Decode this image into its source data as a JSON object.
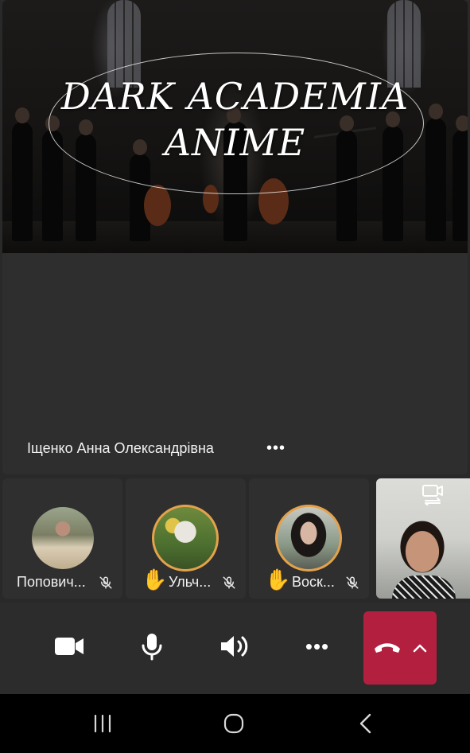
{
  "shared_content": {
    "title_line1": "DARK ACADEMIA",
    "title_line2": "ANIME"
  },
  "presenter": {
    "name": "Іщенко Анна Олександрівна",
    "more_label": "•••"
  },
  "participants": [
    {
      "label": "Попович...",
      "hand_raised": false,
      "muted": true,
      "hand": ""
    },
    {
      "label": "Ульч...",
      "hand_raised": true,
      "muted": true,
      "hand": "✋"
    },
    {
      "label": "Воск...",
      "hand_raised": true,
      "muted": true,
      "hand": "✋"
    }
  ],
  "self_view": {
    "icon": "switch-camera-icon"
  },
  "controls": {
    "camera_icon": "video-camera-icon",
    "mic_icon": "microphone-icon",
    "speaker_icon": "speaker-icon",
    "more_label": "•••",
    "end_call_icon": "hang-up-icon",
    "expand_icon": "chevron-up-icon"
  },
  "colors": {
    "background": "#292929",
    "end_call": "#b3203f",
    "hand_ring": "#e3a24b"
  },
  "system_nav": {
    "recent_icon": "recent-apps-icon",
    "home_icon": "home-icon",
    "back_icon": "back-icon"
  }
}
